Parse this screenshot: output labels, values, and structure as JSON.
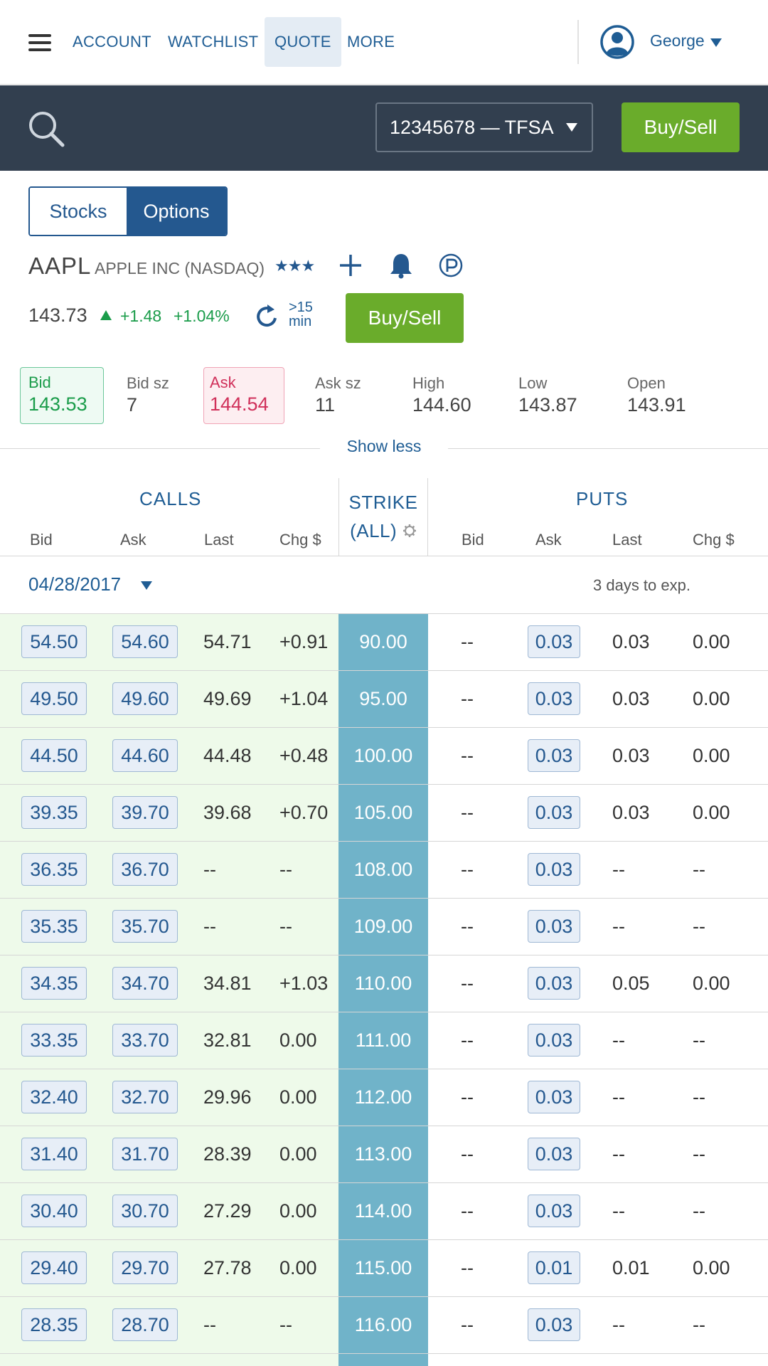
{
  "nav": {
    "links": [
      "ACCOUNT",
      "WATCHLIST",
      "QUOTE",
      "MORE"
    ],
    "active": "QUOTE",
    "user_name": "George"
  },
  "toolbar": {
    "account": "12345678 — TFSA",
    "buy_sell_label": "Buy/Sell"
  },
  "toggle": {
    "stocks": "Stocks",
    "options": "Options",
    "selected": "Options"
  },
  "quote": {
    "symbol": "AAPL",
    "company": "APPLE INC (NASDAQ)",
    "stars": "★★★",
    "last": "143.73",
    "change": "+1.48",
    "change_pct": "+1.04%",
    "delay_line1": ">15",
    "delay_line2": "min",
    "buy_sell_label": "Buy/Sell",
    "stats": {
      "bid_label": "Bid",
      "bid": "143.53",
      "bid_sz_label": "Bid sz",
      "bid_sz": "7",
      "ask_label": "Ask",
      "ask": "144.54",
      "ask_sz_label": "Ask sz",
      "ask_sz": "11",
      "high_label": "High",
      "high": "144.60",
      "low_label": "Low",
      "low": "143.87",
      "open_label": "Open",
      "open": "143.91"
    },
    "show_less": "Show less"
  },
  "chain": {
    "calls_title": "CALLS",
    "puts_title": "PUTS",
    "strike_title_1": "STRIKE",
    "strike_title_2": "(ALL)",
    "columns": {
      "bid": "Bid",
      "ask": "Ask",
      "last": "Last",
      "chg": "Chg $"
    },
    "expiry": "04/28/2017",
    "days_to_exp": "3 days to exp.",
    "rows": [
      {
        "call_bid": "54.50",
        "call_ask": "54.60",
        "call_last": "54.71",
        "call_chg": "+0.91",
        "strike": "90.00",
        "put_bid": "--",
        "put_ask": "0.03",
        "put_last": "0.03",
        "put_chg": "0.00"
      },
      {
        "call_bid": "49.50",
        "call_ask": "49.60",
        "call_last": "49.69",
        "call_chg": "+1.04",
        "strike": "95.00",
        "put_bid": "--",
        "put_ask": "0.03",
        "put_last": "0.03",
        "put_chg": "0.00"
      },
      {
        "call_bid": "44.50",
        "call_ask": "44.60",
        "call_last": "44.48",
        "call_chg": "+0.48",
        "strike": "100.00",
        "put_bid": "--",
        "put_ask": "0.03",
        "put_last": "0.03",
        "put_chg": "0.00"
      },
      {
        "call_bid": "39.35",
        "call_ask": "39.70",
        "call_last": "39.68",
        "call_chg": "+0.70",
        "strike": "105.00",
        "put_bid": "--",
        "put_ask": "0.03",
        "put_last": "0.03",
        "put_chg": "0.00"
      },
      {
        "call_bid": "36.35",
        "call_ask": "36.70",
        "call_last": "--",
        "call_chg": "--",
        "strike": "108.00",
        "put_bid": "--",
        "put_ask": "0.03",
        "put_last": "--",
        "put_chg": "--"
      },
      {
        "call_bid": "35.35",
        "call_ask": "35.70",
        "call_last": "--",
        "call_chg": "--",
        "strike": "109.00",
        "put_bid": "--",
        "put_ask": "0.03",
        "put_last": "--",
        "put_chg": "--"
      },
      {
        "call_bid": "34.35",
        "call_ask": "34.70",
        "call_last": "34.81",
        "call_chg": "+1.03",
        "strike": "110.00",
        "put_bid": "--",
        "put_ask": "0.03",
        "put_last": "0.05",
        "put_chg": "0.00"
      },
      {
        "call_bid": "33.35",
        "call_ask": "33.70",
        "call_last": "32.81",
        "call_chg": "0.00",
        "strike": "111.00",
        "put_bid": "--",
        "put_ask": "0.03",
        "put_last": "--",
        "put_chg": "--"
      },
      {
        "call_bid": "32.40",
        "call_ask": "32.70",
        "call_last": "29.96",
        "call_chg": "0.00",
        "strike": "112.00",
        "put_bid": "--",
        "put_ask": "0.03",
        "put_last": "--",
        "put_chg": "--"
      },
      {
        "call_bid": "31.40",
        "call_ask": "31.70",
        "call_last": "28.39",
        "call_chg": "0.00",
        "strike": "113.00",
        "put_bid": "--",
        "put_ask": "0.03",
        "put_last": "--",
        "put_chg": "--"
      },
      {
        "call_bid": "30.40",
        "call_ask": "30.70",
        "call_last": "27.29",
        "call_chg": "0.00",
        "strike": "114.00",
        "put_bid": "--",
        "put_ask": "0.03",
        "put_last": "--",
        "put_chg": "--"
      },
      {
        "call_bid": "29.40",
        "call_ask": "29.70",
        "call_last": "27.78",
        "call_chg": "0.00",
        "strike": "115.00",
        "put_bid": "--",
        "put_ask": "0.01",
        "put_last": "0.01",
        "put_chg": "0.00"
      },
      {
        "call_bid": "28.35",
        "call_ask": "28.70",
        "call_last": "--",
        "call_chg": "--",
        "strike": "116.00",
        "put_bid": "--",
        "put_ask": "0.03",
        "put_last": "--",
        "put_chg": "--"
      }
    ]
  },
  "colors": {
    "brand_blue": "#1f5d94",
    "dark_bar": "#323f4f",
    "buy_green": "#6aac2b",
    "up_green": "#1a9c4a",
    "ask_red": "#d0305a",
    "strike_teal": "#70b3c9",
    "calls_bg": "#eefaea"
  }
}
